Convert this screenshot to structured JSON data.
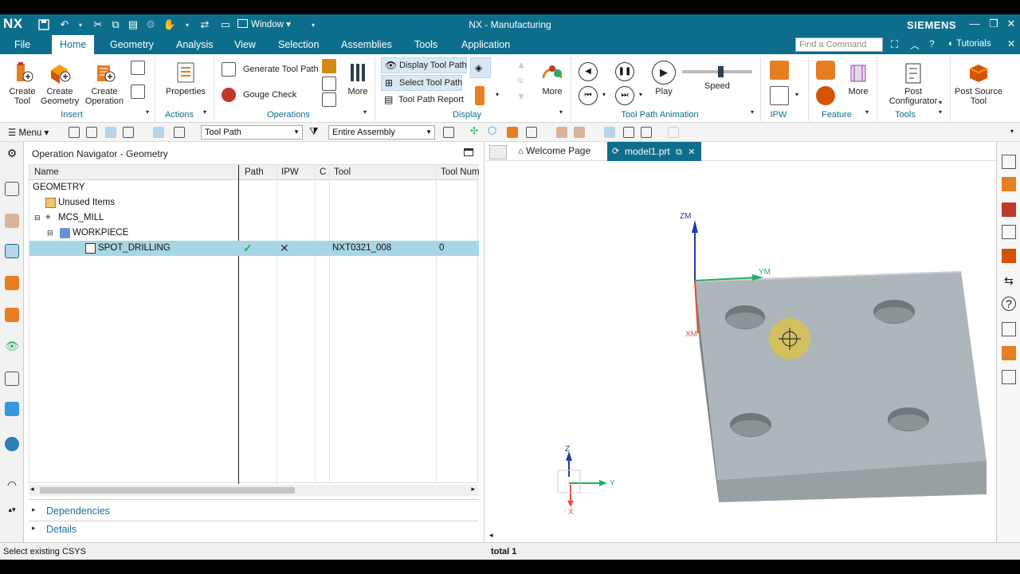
{
  "app": {
    "logo": "NX",
    "window_menu": "Window ▾",
    "title": "NX - Manufacturing",
    "brand": "SIEMENS"
  },
  "menu": {
    "tabs": [
      "File",
      "Home",
      "Geometry",
      "Analysis",
      "View",
      "Selection",
      "Assemblies",
      "Tools",
      "Application"
    ],
    "active": "Home",
    "find_placeholder": "Find a Command",
    "tutorials": "Tutorials"
  },
  "ribbon": {
    "insert": {
      "create_tool": "Create Tool",
      "create_geometry": "Create Geometry",
      "create_operation": "Create Operation",
      "label": "Insert"
    },
    "actions": {
      "properties": "Properties",
      "label": "Actions"
    },
    "operations": {
      "generate_tool_path": "Generate Tool Path",
      "gouge_check": "Gouge Check",
      "more": "More",
      "label": "Operations"
    },
    "display": {
      "display_tool_path": "Display Tool Path",
      "select_tool_path": "Select Tool Path",
      "tool_path_report": "Tool Path Report",
      "more": "More",
      "label": "Display"
    },
    "animation": {
      "play": "Play",
      "speed": "Speed",
      "label": "Tool Path Animation",
      "speed_level": 0.55
    },
    "ipw": {
      "label": "IPW"
    },
    "feature": {
      "more": "More",
      "label": "Feature"
    },
    "tools": {
      "post_configurator": "Post Configurator",
      "post_source_tool": "Post Source Tool",
      "label": "Tools"
    }
  },
  "toolbar2": {
    "menu": "Menu",
    "filter1": "Tool Path",
    "filter2": "Entire Assembly"
  },
  "navigator": {
    "title": "Operation Navigator - Geometry",
    "columns": [
      "Name",
      "Path",
      "IPW",
      "C",
      "Tool",
      "Tool Num"
    ],
    "rows": [
      {
        "name": "GEOMETRY",
        "path": "",
        "ipw": "",
        "tool": "",
        "num": ""
      },
      {
        "name": "Unused Items",
        "path": "",
        "ipw": "",
        "tool": "",
        "num": ""
      },
      {
        "name": "MCS_MILL",
        "path": "",
        "ipw": "",
        "tool": "",
        "num": ""
      },
      {
        "name": "WORKPIECE",
        "path": "",
        "ipw": "",
        "tool": "",
        "num": ""
      },
      {
        "name": "SPOT_DRILLING",
        "path": "✓",
        "ipw": "✕",
        "tool": "NXT0321_008",
        "num": "0"
      }
    ],
    "dependencies": "Dependencies",
    "details": "Details"
  },
  "viewtabs": {
    "welcome": "Welcome Page",
    "model": "model1.prt"
  },
  "viewport": {
    "zm": "ZM",
    "ym": "YM",
    "xm": "XM",
    "tz": "Z",
    "ty": "Y",
    "tx": "X"
  },
  "status": {
    "left": "Select existing CSYS",
    "right": "total 1"
  }
}
